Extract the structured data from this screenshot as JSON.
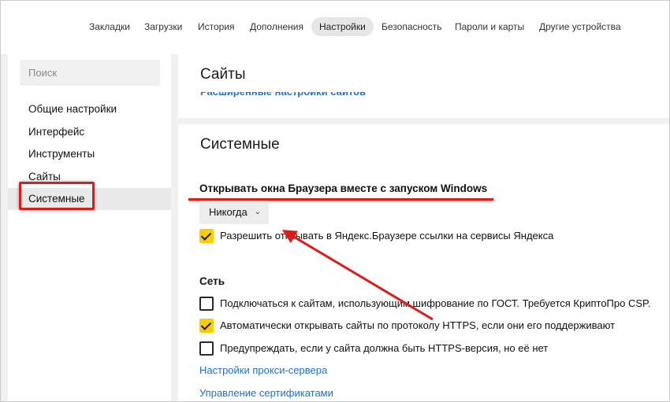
{
  "topnav": {
    "tabs": [
      {
        "label": "Закладки"
      },
      {
        "label": "Загрузки"
      },
      {
        "label": "История"
      },
      {
        "label": "Дополнения"
      },
      {
        "label": "Настройки",
        "active": true
      },
      {
        "label": "Безопасность"
      },
      {
        "label": "Пароли и карты"
      },
      {
        "label": "Другие устройства"
      }
    ]
  },
  "sidebar": {
    "search_placeholder": "Поиск",
    "items": [
      {
        "label": "Общие настройки"
      },
      {
        "label": "Интерфейс"
      },
      {
        "label": "Инструменты"
      },
      {
        "label": "Сайты"
      },
      {
        "label": "Системные",
        "active": true
      }
    ]
  },
  "sites_card": {
    "title": "Сайты",
    "partial_link": "Расширенные настройки сайтов"
  },
  "system_card": {
    "title": "Системные",
    "startup_label": "Открывать окна Браузера вместе с запуском Windows",
    "startup_value": "Никогда",
    "allow_links_label": "Разрешить открывать в Яндекс.Браузере ссылки на сервисы Яндекса",
    "allow_links_checked": true,
    "network_heading": "Сеть",
    "network_options": [
      {
        "label": "Подключаться к сайтам, использующим шифрование по ГОСТ. Требуется КриптоПро CSP.",
        "checked": false
      },
      {
        "label": "Автоматически открывать сайты по протоколу HTTPS, если они его поддерживают",
        "checked": true
      },
      {
        "label": "Предупреждать, если у сайта должна быть HTTPS-версия, но её нет",
        "checked": false
      }
    ],
    "proxy_link": "Настройки прокси-сервера",
    "certs_link": "Управление сертификатами"
  },
  "colors": {
    "accent_link": "#1e73c8",
    "checkbox_on": "#ffcc00",
    "annotation_red": "#e01b1b"
  }
}
